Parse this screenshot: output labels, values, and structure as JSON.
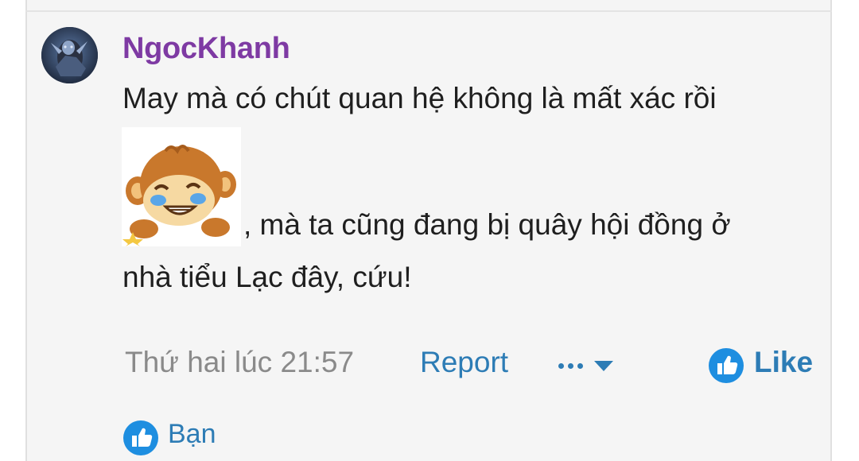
{
  "post": {
    "username": "NgocKhanh",
    "message_line1": "May mà có chút quan hệ không là mất xác rồi",
    "message_line2": ", mà ta cũng đang bị quây hội đồng ở",
    "message_line3": "nhà tiểu Lạc đây, cứu!",
    "emoji_image": "crying-monkey-emoji",
    "timestamp": "Thứ hai lúc 21:57"
  },
  "actions": {
    "report_label": "Report",
    "more_icon": "more-options-icon",
    "like_label": "Like",
    "like_icon": "thumbs-up-icon"
  },
  "reactions": {
    "names": "Bạn",
    "icon": "thumbs-up-icon"
  },
  "colors": {
    "username": "#7e3aa3",
    "link": "#2d7cb5",
    "meta": "#8a8a8a",
    "text": "#1f1f1f",
    "background": "#f5f5f5"
  }
}
